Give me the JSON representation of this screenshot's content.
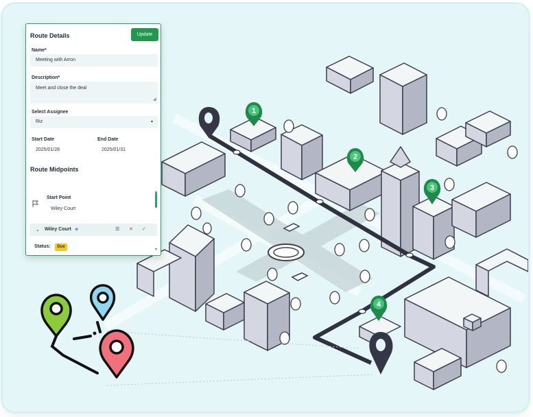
{
  "route_details": {
    "title": "Route Details",
    "update_label": "Update",
    "name_label": "Name*",
    "name_value": "Meeting with Arron",
    "description_label": "Description*",
    "description_value": "Meet and close the deal",
    "assignee_label": "Select Assignee",
    "assignee_value": "Riz",
    "start_date_label": "Start Date",
    "start_date_value": "2025/01/28",
    "end_date_label": "End Date",
    "end_date_value": "2025/01/31",
    "midpoints_title": "Route Midpoints",
    "start_point_label": "Start Point",
    "start_point_value": "Wiley Court",
    "midpoint_name": "Wiley Court",
    "status_label": "Status:",
    "status_value": "Due"
  },
  "map": {
    "pins": [
      "1",
      "2",
      "3",
      "4"
    ],
    "route_color": "#2f3040",
    "pin_color": "#1e8a4a",
    "background": "#e4f6f7"
  },
  "colors": {
    "accent": "#1f9a4c",
    "badge": "#f4c81e"
  }
}
